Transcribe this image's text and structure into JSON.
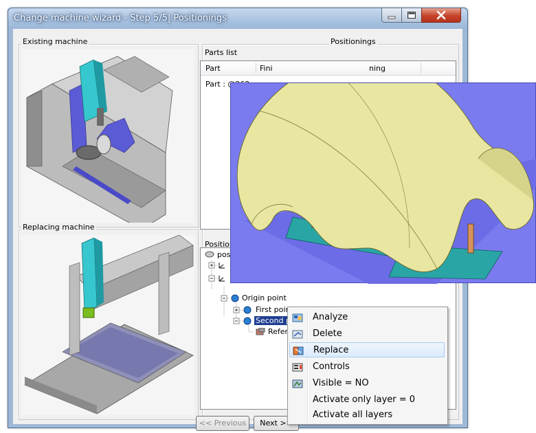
{
  "window": {
    "title": "Change machine wizard - Step 5/5| Positionings"
  },
  "groups": {
    "existing_machine": "Existing machine",
    "replacing_machine": "Replacing machine",
    "positionings": "Positionings",
    "parts_list": "Parts list",
    "positioning_tree": "Positioni"
  },
  "parts_list": {
    "columns": [
      "Part",
      "Fini",
      "ning"
    ],
    "rows": [
      {
        "part": "Part : @262"
      }
    ]
  },
  "tree": {
    "root": "posi",
    "origin_point": "Origin point",
    "first_point": "First point",
    "second_point": "Second p",
    "reference": "Refer"
  },
  "buttons": {
    "previous": "<< Previous",
    "next": "Next >>"
  },
  "context_menu": {
    "items": [
      {
        "label": "Analyze",
        "icon": "analyze-icon"
      },
      {
        "label": "Delete",
        "icon": "delete-icon"
      },
      {
        "label": "Replace",
        "icon": "replace-icon"
      },
      {
        "label": "Controls",
        "icon": "controls-icon"
      },
      {
        "label": "Visible = NO",
        "icon": "visibility-icon"
      },
      {
        "label": "Activate only layer = 0",
        "icon": ""
      },
      {
        "label": "Activate all layers",
        "icon": ""
      }
    ],
    "highlighted_index": 2
  },
  "colors": {
    "selection": "#1f3e90",
    "menu_highlight": "#dcebfc",
    "part_surface": "#e8e6a0",
    "viewport_floor": "#7b7bf0",
    "fixture": "#2aa5a5",
    "machine_cyan": "#37c7cf",
    "machine_blue": "#5b5bd6"
  }
}
